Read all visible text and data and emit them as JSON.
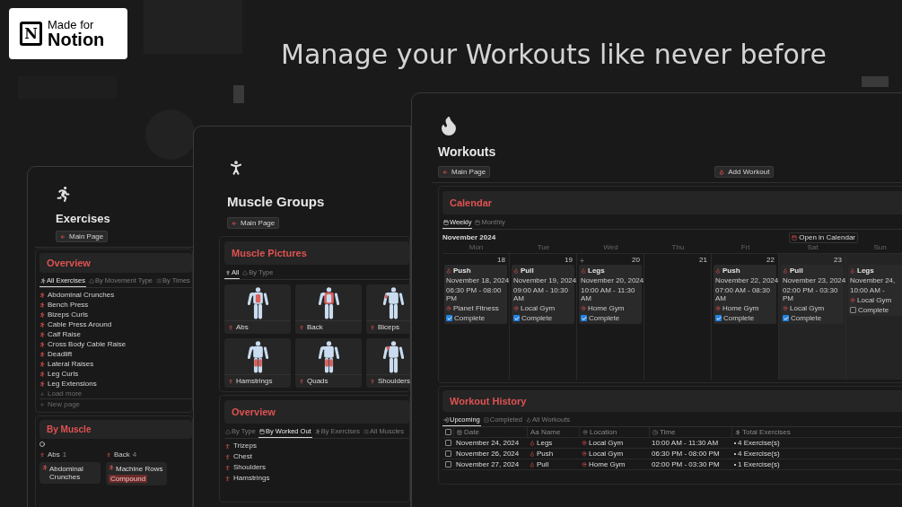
{
  "badge": {
    "logo_letter": "N",
    "line1": "Made for",
    "line2": "Notion"
  },
  "headline": "Manage your Workouts like never before",
  "exercises_page": {
    "title": "Exercises",
    "back_button": "Main Page",
    "overview": {
      "title": "Overview",
      "tabs": [
        {
          "label": "All Exercises",
          "selected": true
        },
        {
          "label": "By Movement Type",
          "selected": false
        },
        {
          "label": "By Times",
          "selected": false
        }
      ],
      "items": [
        "Abdominal Crunches",
        "Bench Press",
        "Bizeps Curls",
        "Cable Press Around",
        "Calf Raise",
        "Cross Body Cable Raise",
        "Deadlift",
        "Lateral Raises",
        "Leg Curls",
        "Leg Extensions"
      ],
      "load_more": "Load more",
      "new_page": "New page"
    },
    "by_muscle": {
      "title": "By Muscle",
      "columns": [
        {
          "name": "Abs",
          "count": "1",
          "cards": [
            {
              "name": "Abdominal Crunches"
            }
          ]
        },
        {
          "name": "Back",
          "count": "4",
          "cards": [
            {
              "name": "Machine Rows",
              "tags": [
                "Compound"
              ]
            }
          ]
        }
      ]
    }
  },
  "muscle_groups_page": {
    "title": "Muscle Groups",
    "back_button": "Main Page",
    "pictures": {
      "title": "Muscle Pictures",
      "tabs": [
        {
          "label": "All",
          "selected": true
        },
        {
          "label": "By Type",
          "selected": false
        }
      ],
      "cards": [
        {
          "label": "Abs",
          "kind": "abs"
        },
        {
          "label": "Back",
          "kind": "back"
        },
        {
          "label": "Biceps",
          "kind": "arm"
        },
        {
          "label": "Hamstrings",
          "kind": "hamstrings"
        },
        {
          "label": "Quads",
          "kind": "quads"
        },
        {
          "label": "Shoulders",
          "kind": "shoulder"
        }
      ]
    },
    "overview": {
      "title": "Overview",
      "tabs": [
        {
          "label": "By Type",
          "selected": false
        },
        {
          "label": "By Worked Out",
          "selected": true
        },
        {
          "label": "By Exercises",
          "selected": false
        },
        {
          "label": "All Muscles",
          "selected": false
        }
      ],
      "items": [
        "Trizeps",
        "Chest",
        "Shoulders",
        "Hamstrings"
      ]
    }
  },
  "workouts_page": {
    "title": "Workouts",
    "buttons": [
      {
        "kind": "back",
        "label": "Main Page"
      },
      {
        "kind": "add",
        "label": "Add Workout"
      }
    ],
    "calendar": {
      "title": "Calendar",
      "tabs": [
        {
          "label": "Weekly",
          "selected": true
        },
        {
          "label": "Monthly",
          "selected": false
        }
      ],
      "month": "November 2024",
      "open_button": "Open in Calendar",
      "weekdays": [
        "Mon",
        "Tue",
        "Wed",
        "Thu",
        "Fri",
        "Sat",
        "Sun"
      ],
      "days": [
        {
          "number": "18",
          "add_button": false,
          "weekend": false,
          "event": {
            "name": "Push",
            "date": "November 18, 2024",
            "time": "06:30 PM - 08:00 PM",
            "location": "Planet Fitness",
            "complete": true,
            "complete_label": "Complete"
          }
        },
        {
          "number": "19",
          "add_button": false,
          "weekend": false,
          "event": {
            "name": "Pull",
            "date": "November 19, 2024",
            "time": "09:00 AM - 10:30 AM",
            "location": "Local Gym",
            "complete": true,
            "complete_label": "Complete"
          }
        },
        {
          "number": "20",
          "add_button": true,
          "weekend": false,
          "event": {
            "name": "Legs",
            "date": "November 20, 2024",
            "time": "10:00 AM - 11:30 AM",
            "location": "Home Gym",
            "complete": true,
            "complete_label": "Complete"
          }
        },
        {
          "number": "21",
          "add_button": false,
          "weekend": false
        },
        {
          "number": "22",
          "add_button": false,
          "weekend": false,
          "event": {
            "name": "Push",
            "date": "November 22, 2024",
            "time": "07:00 AM - 08:30 AM",
            "location": "Home Gym",
            "complete": true,
            "complete_label": "Complete"
          }
        },
        {
          "number": "23",
          "add_button": false,
          "weekend": true,
          "event": {
            "name": "Pull",
            "date": "November 23, 2024",
            "time": "02:00 PM - 03:30 PM",
            "location": "Local Gym",
            "complete": true,
            "complete_label": "Complete"
          }
        },
        {
          "add_button": false,
          "weekend": true,
          "event": {
            "name": "Legs",
            "date": "November 24,",
            "time": "10:00 AM -",
            "location": "Local Gym",
            "complete": false,
            "complete_label": "Complete"
          }
        }
      ]
    },
    "history": {
      "title": "Workout History",
      "tabs": [
        {
          "label": "Upcoming",
          "selected": true
        },
        {
          "label": "Completed",
          "selected": false
        },
        {
          "label": "All Workouts",
          "selected": false
        }
      ],
      "all_checked": false,
      "columns": [
        "Date",
        "Aa Name",
        "Location",
        "Time",
        "Total Exercises"
      ],
      "rows": [
        {
          "checked": false,
          "date": "November 24, 2024",
          "name": "Legs",
          "location": "Local Gym",
          "time": "10:00 AM - 11:30 AM",
          "total": "4 Exercise(s)"
        },
        {
          "checked": false,
          "date": "November 26, 2024",
          "name": "Push",
          "location": "Local Gym",
          "time": "06:30 PM - 08:00 PM",
          "total": "4 Exercise(s)"
        },
        {
          "checked": false,
          "date": "November 27, 2024",
          "name": "Pull",
          "location": "Home Gym",
          "time": "02:00 PM - 03:30 PM",
          "total": "1 Exercise(s)"
        }
      ]
    }
  }
}
